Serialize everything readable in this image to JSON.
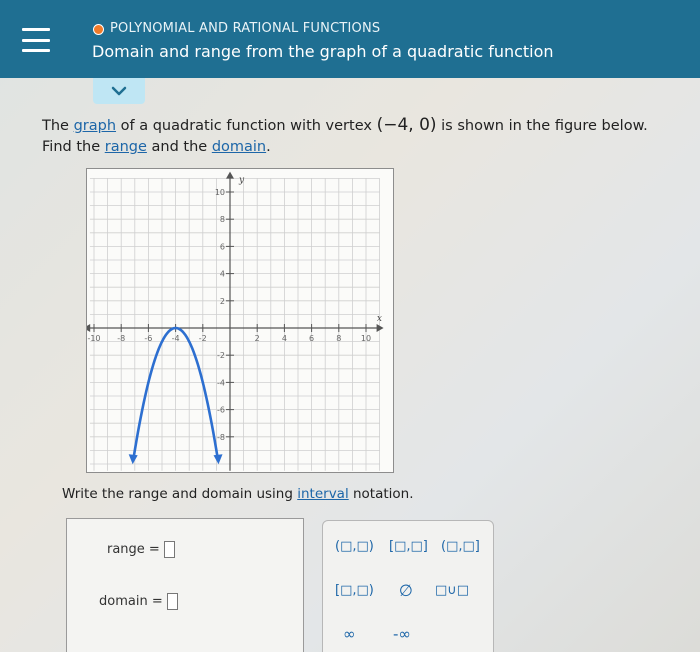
{
  "header": {
    "topic": "POLYNOMIAL AND RATIONAL FUNCTIONS",
    "subtitle": "Domain and range from the graph of a quadratic function",
    "topic_dot_color": "#f07b2a",
    "bar_color": "#1f6f92"
  },
  "question": {
    "part1": "The ",
    "link_graph": "graph",
    "part2": " of a quadratic function with vertex ",
    "vertex": "(−4, 0)",
    "part3": " is shown in the figure below.",
    "part4": "Find the ",
    "link_range": "range",
    "part5": " and the ",
    "link_domain": "domain",
    "part6": "."
  },
  "graph": {
    "x_label": "x",
    "y_label": "y",
    "x_ticks": [
      "-10",
      "-8",
      "-6",
      "-4",
      "-2",
      "2",
      "4",
      "6",
      "8",
      "10"
    ],
    "y_ticks": [
      "10",
      "8",
      "6",
      "4",
      "2",
      "-2",
      "-4",
      "-6",
      "-8"
    ],
    "curve_color": "#2d6fd0"
  },
  "instruction": {
    "part1": "Write the range and domain using ",
    "link_interval": "interval",
    "part2": " notation."
  },
  "answers": {
    "range_label": "range =",
    "domain_label": "domain ="
  },
  "keypad": {
    "k1": "(□,□)",
    "k2": "[□,□]",
    "k3": "(□,□]",
    "k4": "[□,□)",
    "k5": "∅",
    "k6": "□∪□",
    "k7": "∞",
    "k8": "-∞"
  }
}
